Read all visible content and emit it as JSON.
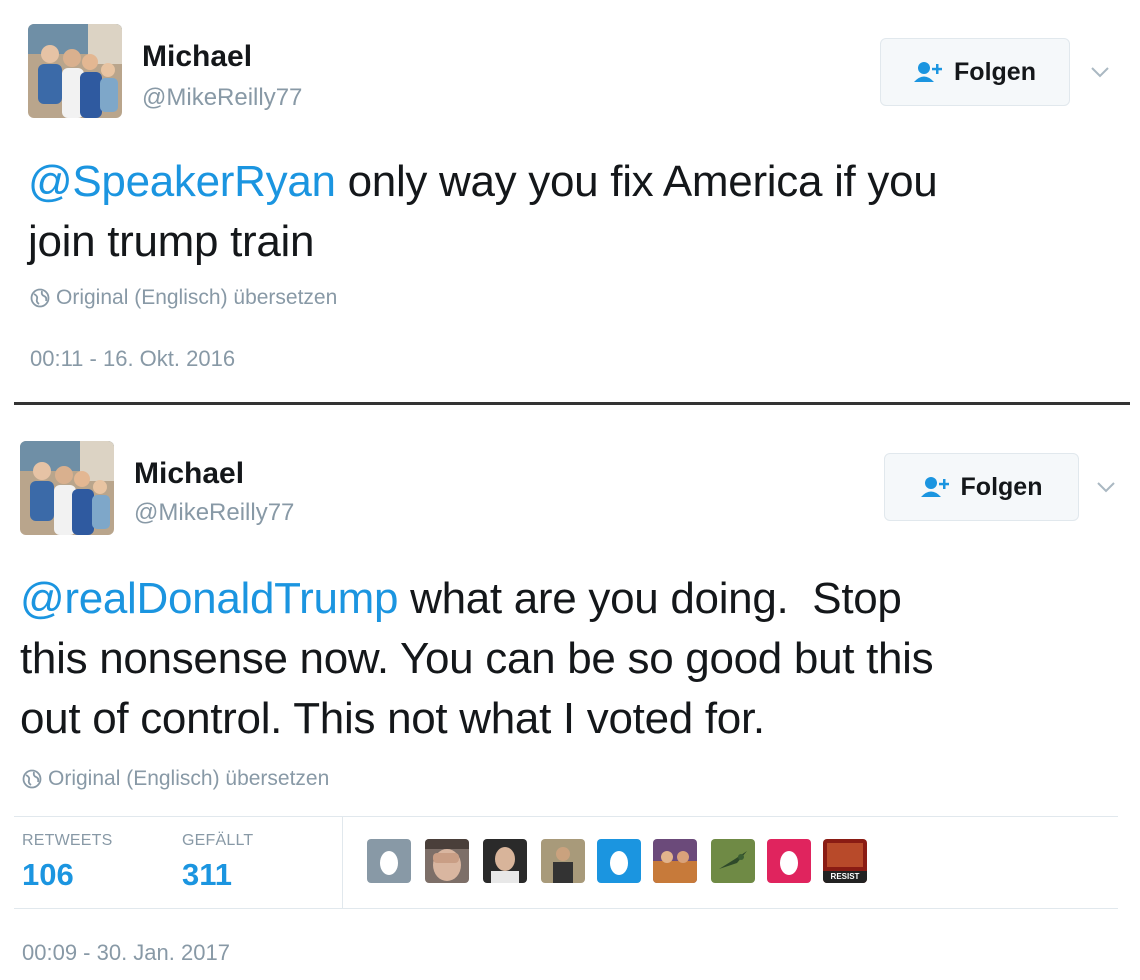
{
  "tweets": [
    {
      "author_name": "Michael",
      "author_handle": "@MikeReilly77",
      "follow_label": "Folgen",
      "mention": "@SpeakerRyan",
      "body_line1": " only way you fix America if you",
      "body_line2": "join trump train",
      "translate_label": "Original (Englisch) übersetzen",
      "timestamp": "00:11 - 16. Okt. 2016"
    },
    {
      "author_name": "Michael",
      "author_handle": "@MikeReilly77",
      "follow_label": "Folgen",
      "mention": "@realDonaldTrump",
      "body_line1": " what are you doing.  Stop",
      "body_line2": "this nonsense now. You can be so good but this",
      "body_line3": "out of control. This not what I voted for.",
      "translate_label": "Original (Englisch) übersetzen",
      "retweets_label": "RETWEETS",
      "retweets_count": "106",
      "likes_label": "GEFÄLLT",
      "likes_count": "311",
      "liker_badge_text": "RESIST",
      "timestamp": "00:09 - 30. Jan. 2017"
    }
  ],
  "colors": {
    "mention": "#1b95e0",
    "muted": "#8899a6",
    "text": "#14171a",
    "follow_icon": "#1b95e0",
    "divider": "#333333"
  },
  "icons": {
    "follow": "add-user-icon",
    "menu": "chevron-down-icon",
    "translate": "globe-icon"
  }
}
